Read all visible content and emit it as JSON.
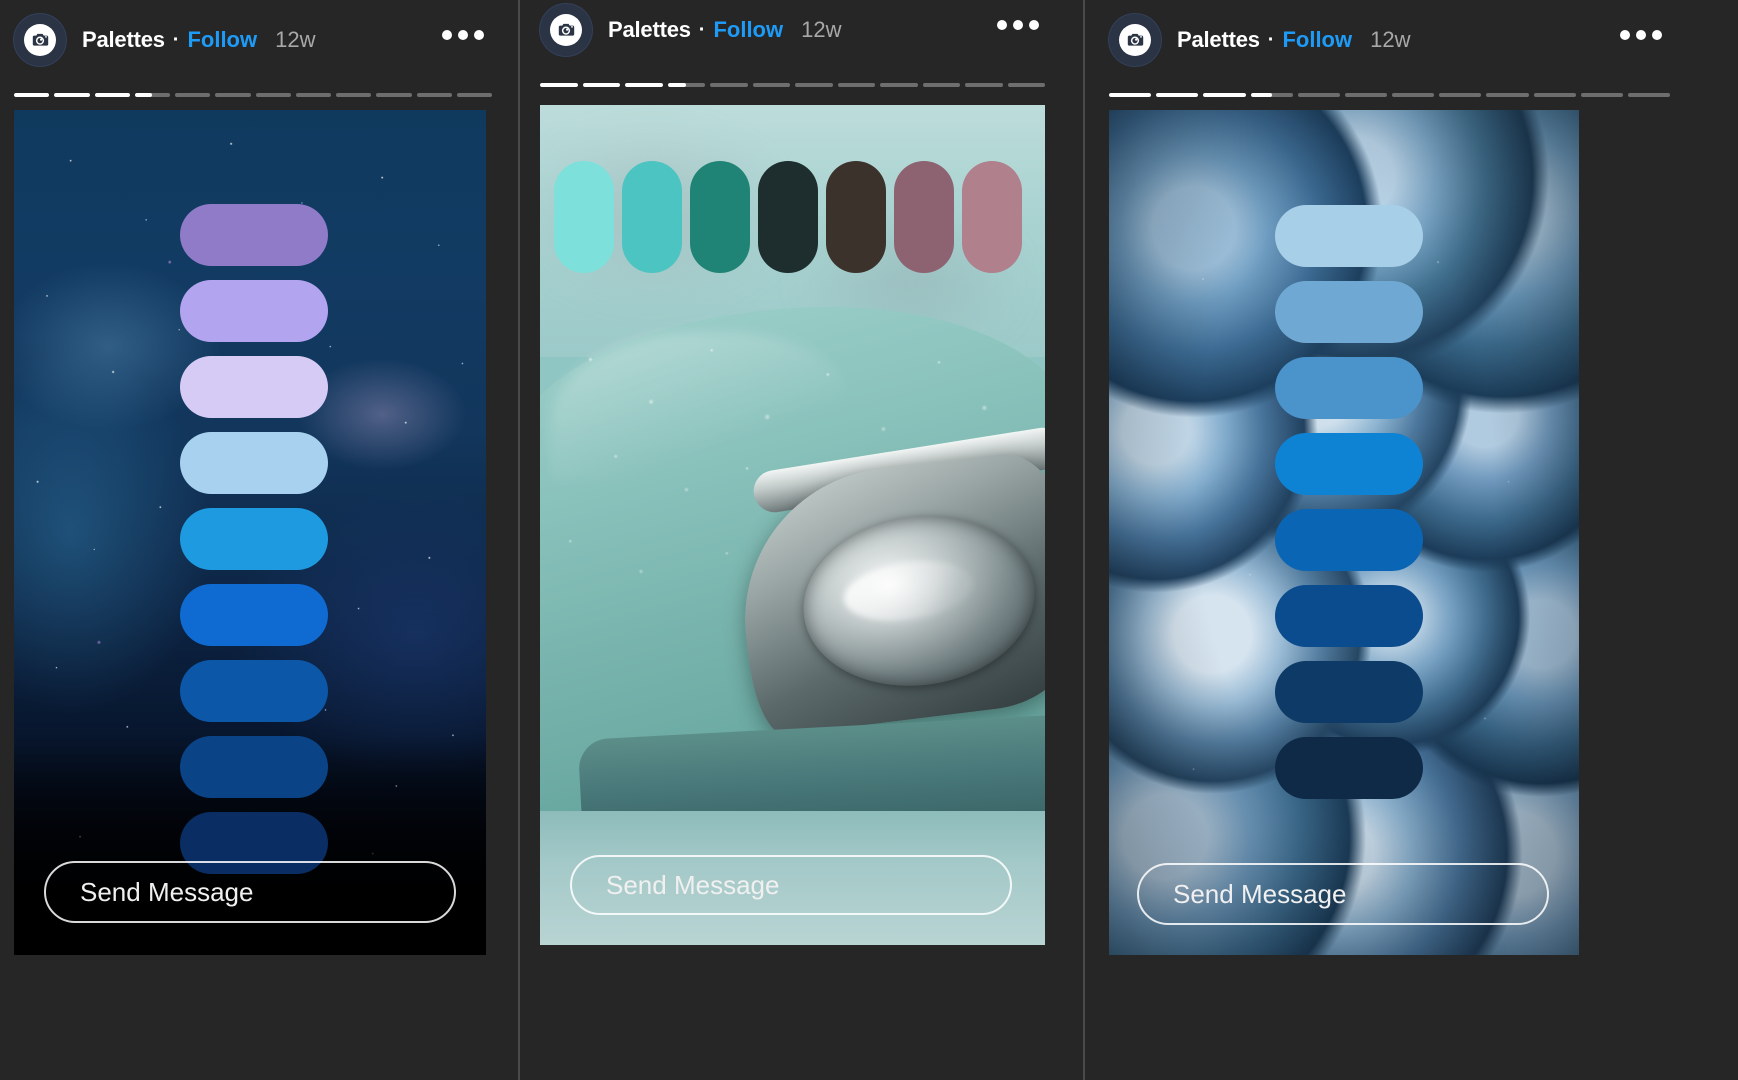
{
  "app": {
    "background": "#262626",
    "accent": "#1d9bf7"
  },
  "panels": [
    {
      "id": "panel-1",
      "header": {
        "avatar_icon": "camera-icon",
        "username": "Palettes",
        "separator": "·",
        "follow_label": "Follow",
        "timestamp": "12w",
        "more_icon": "ellipsis-icon"
      },
      "progress": {
        "segments": 12,
        "completed": 3,
        "current_fill_percent": 50
      },
      "story": {
        "image_description": "galaxy-nebula-starfield",
        "palette_orientation": "vertical",
        "palette": [
          "#8f7bc8",
          "#b3a4f0",
          "#d6cbf5",
          "#a7d1ef",
          "#1e9ae0",
          "#0f6bd1",
          "#0c57a8",
          "#0a4486",
          "#0a2d63"
        ]
      },
      "send_button": {
        "label": "Send Message"
      }
    },
    {
      "id": "panel-2",
      "header": {
        "avatar_icon": "camera-icon",
        "username": "Palettes",
        "separator": "·",
        "follow_label": "Follow",
        "timestamp": "12w",
        "more_icon": "ellipsis-icon"
      },
      "progress": {
        "segments": 12,
        "completed": 3,
        "current_fill_percent": 50
      },
      "story": {
        "image_description": "mint-green-classic-car-headlight-with-water-droplets",
        "palette_orientation": "horizontal",
        "palette": [
          "#7ee0da",
          "#4cc4c1",
          "#1f8476",
          "#1e2d2e",
          "#3c322c",
          "#8e6371",
          "#b0808c"
        ]
      },
      "send_button": {
        "label": "Send Message"
      }
    },
    {
      "id": "panel-3",
      "header": {
        "avatar_icon": "camera-icon",
        "username": "Palettes",
        "separator": "·",
        "follow_label": "Follow",
        "timestamp": "12w",
        "more_icon": "ellipsis-icon"
      },
      "progress": {
        "segments": 12,
        "completed": 3,
        "current_fill_percent": 50
      },
      "story": {
        "image_description": "macro-photo-of-fresh-blueberries",
        "palette_orientation": "vertical",
        "palette": [
          "#a8cfe8",
          "#6fa8d2",
          "#4a93cb",
          "#0e83d4",
          "#0a66b5",
          "#0b4c8e",
          "#0d3a66",
          "#0f2a46"
        ]
      },
      "send_button": {
        "label": "Send Message"
      }
    }
  ]
}
